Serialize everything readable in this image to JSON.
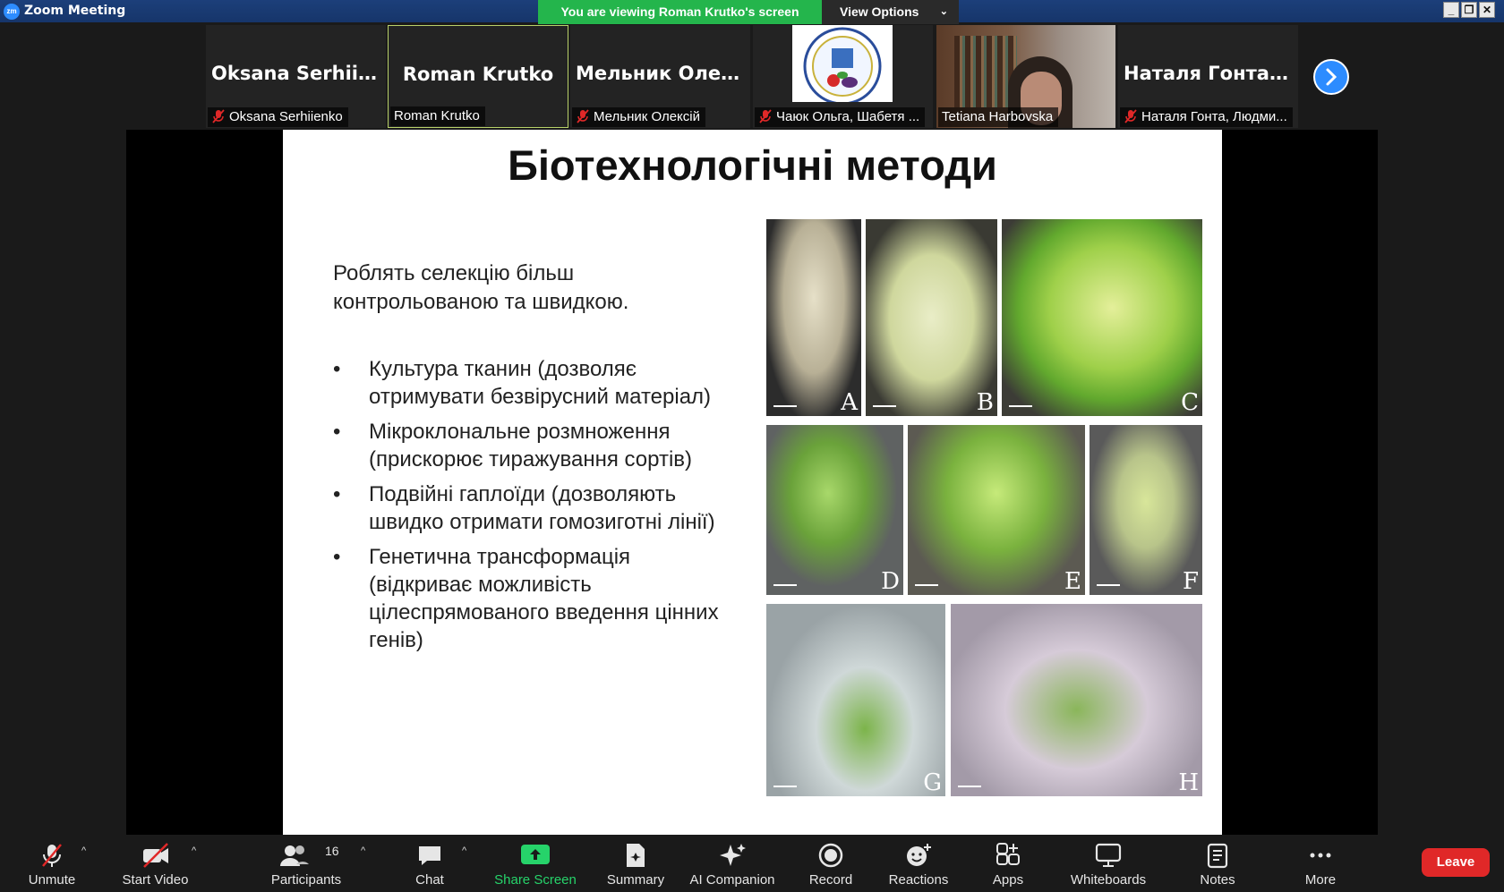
{
  "window": {
    "title": "Zoom Meeting",
    "logo": "zm"
  },
  "banner": {
    "viewing": "You are viewing Roman Krutko's screen",
    "view_options": "View Options"
  },
  "gallery": {
    "tiles": [
      {
        "display": "Oksana  Serhiien...",
        "label": "Oksana Serhiienko",
        "muted": true
      },
      {
        "display": "Roman Krutko",
        "label": "Roman Krutko",
        "muted": false
      },
      {
        "display": "Мельник  Олек...",
        "label": "Мельник Олексій",
        "muted": true
      },
      {
        "display": "",
        "label": "Чаюк Ольга, Шабетя ...",
        "muted": true
      },
      {
        "display": "",
        "label": "Tetiana Harbovska",
        "muted": false
      },
      {
        "display": "Наталя  Гонта,...",
        "label": "Наталя Гонта, Людми...",
        "muted": true
      }
    ]
  },
  "slide": {
    "title": "Біотехнологічні методи",
    "intro": "Роблять селекцію більш контрольованою та швидкою.",
    "bullets": [
      "Культура тканин (дозволяє отримувати безвірусний матеріал)",
      "Мікроклональне розмноження (прискорює тиражування сортів)",
      "Подвійні гаплоїди (дозволяють швидко отримати гомозиготні лінії)",
      "Генетична трансформація (відкриває можливість цілеспрямованого введення цінних генів)"
    ],
    "photos": [
      "A",
      "B",
      "C",
      "D",
      "E",
      "F",
      "G",
      "H"
    ]
  },
  "toolbar": {
    "unmute": "Unmute",
    "start_video": "Start Video",
    "participants": "Participants",
    "participants_count": "16",
    "chat": "Chat",
    "share_screen": "Share Screen",
    "summary": "Summary",
    "ai_companion": "AI Companion",
    "record": "Record",
    "reactions": "Reactions",
    "apps": "Apps",
    "whiteboards": "Whiteboards",
    "notes": "Notes",
    "more": "More",
    "leave": "Leave"
  },
  "colors": {
    "accent": "#2d8cff",
    "share_green": "#24b54c",
    "leave_red": "#e02828",
    "mute_red": "#e02828"
  }
}
